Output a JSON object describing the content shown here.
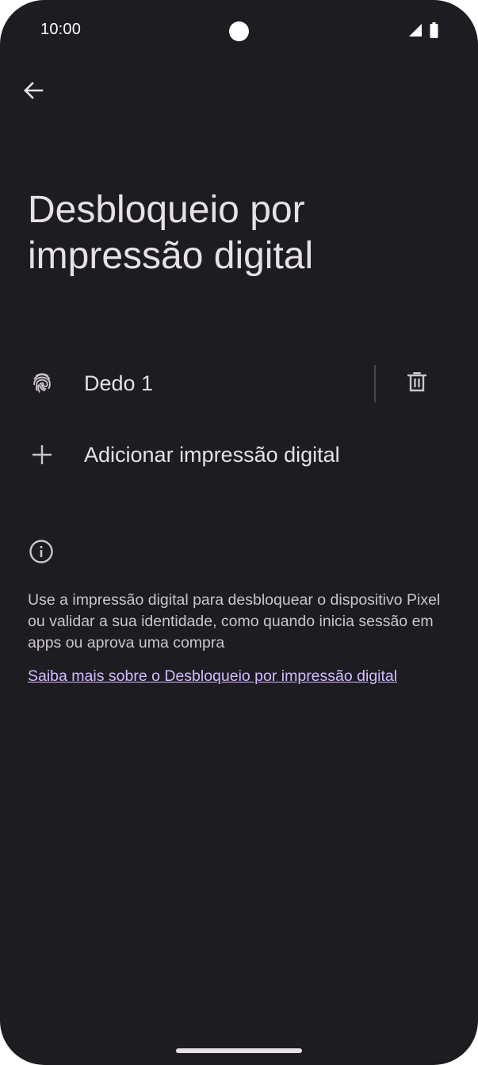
{
  "status_bar": {
    "time": "10:00"
  },
  "header": {
    "title": "Desbloqueio por impressão digital"
  },
  "fingerprints": [
    {
      "label": "Dedo 1"
    }
  ],
  "add_fingerprint": {
    "label": "Adicionar impressão digital"
  },
  "info": {
    "text": "Use a impressão digital para desbloquear o dispositivo Pixel ou validar a sua identidade, como quando inicia sessão em apps ou aprova uma compra",
    "link": "Saiba mais sobre o Desbloqueio por impressão digital"
  },
  "colors": {
    "background": "#1d1c21",
    "text_primary": "#e6e1e6",
    "text_secondary": "#cac4cf",
    "link": "#d3bbff"
  },
  "icons": {
    "back": "arrow-back-icon",
    "fingerprint": "fingerprint-icon",
    "delete": "trash-icon",
    "add": "plus-icon",
    "info": "info-icon"
  }
}
